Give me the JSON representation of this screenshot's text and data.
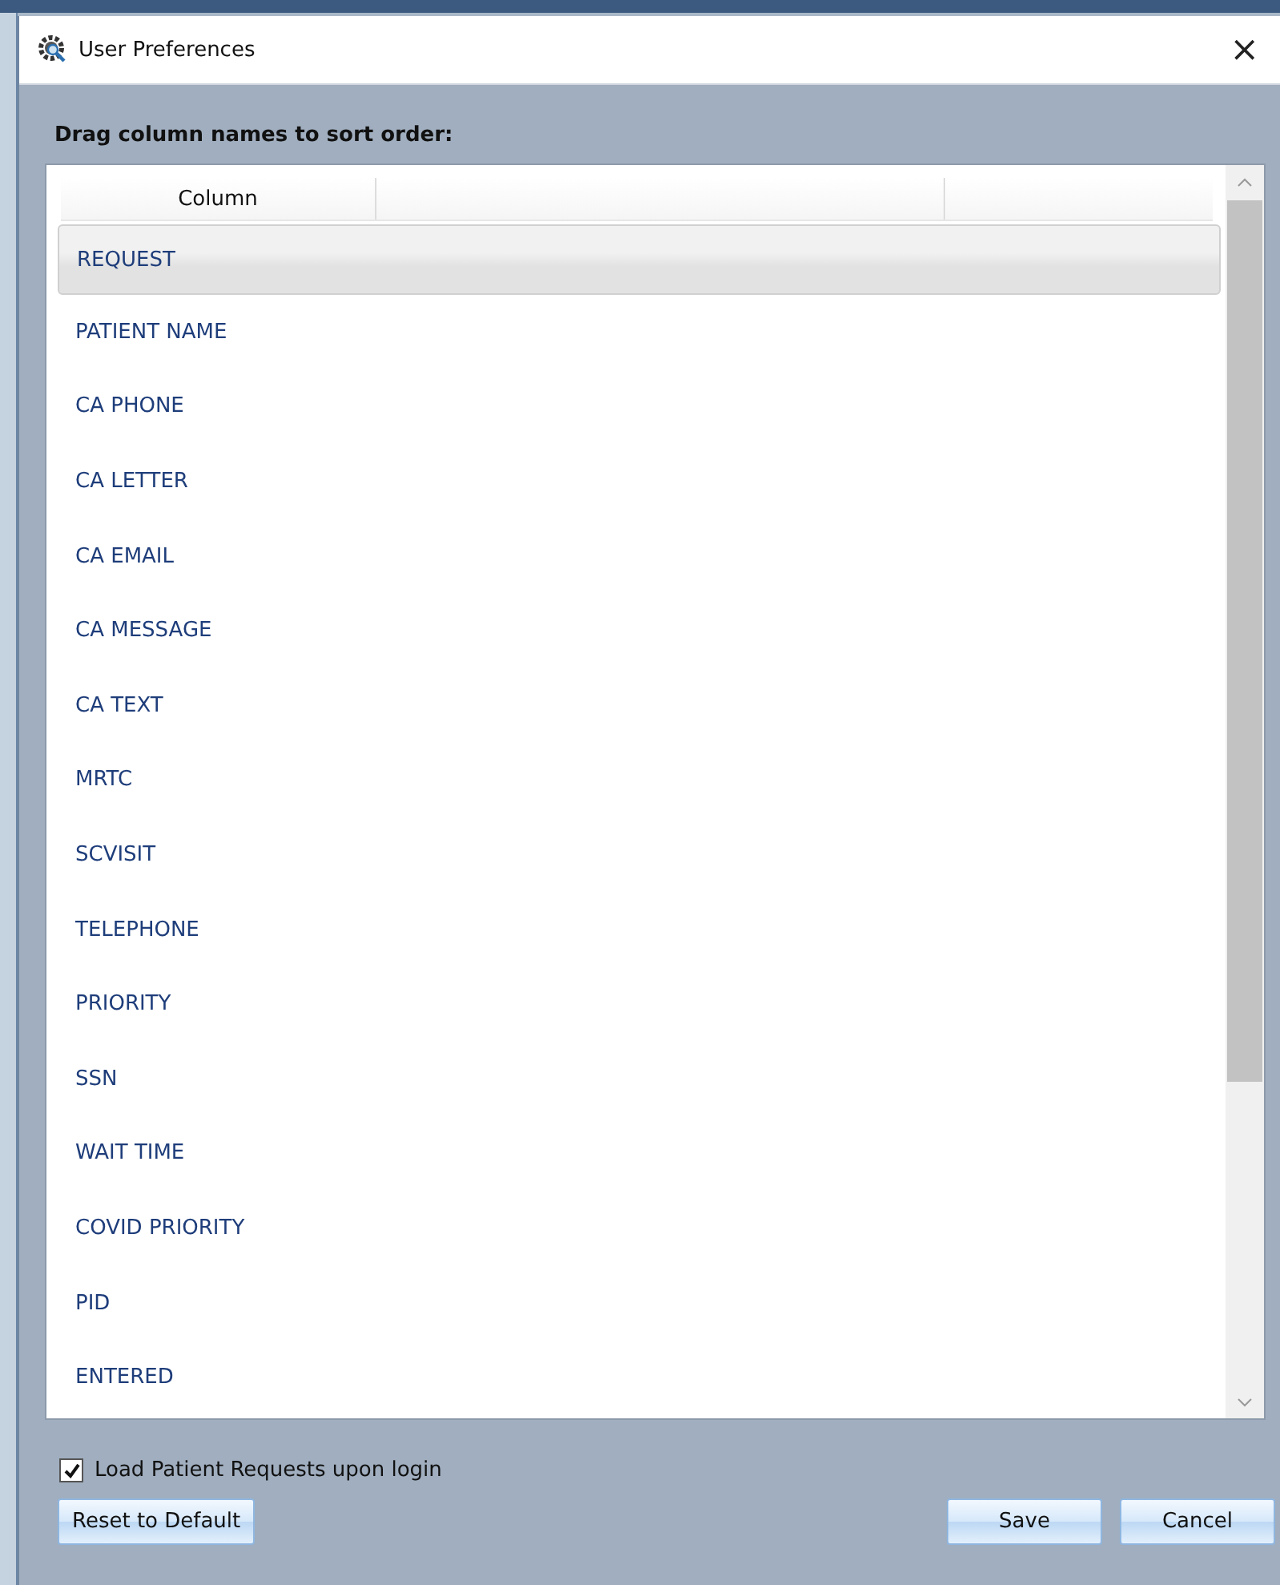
{
  "window": {
    "title": "User Preferences",
    "close": "×"
  },
  "instruction": "Drag column names to sort order:",
  "table": {
    "columns": [
      "Column"
    ],
    "rows": [
      {
        "label": "REQUEST",
        "selected": true
      },
      {
        "label": "PATIENT NAME",
        "selected": false
      },
      {
        "label": "CA PHONE",
        "selected": false
      },
      {
        "label": "CA LETTER",
        "selected": false
      },
      {
        "label": "CA EMAIL",
        "selected": false
      },
      {
        "label": "CA MESSAGE",
        "selected": false
      },
      {
        "label": "CA TEXT",
        "selected": false
      },
      {
        "label": "MRTC",
        "selected": false
      },
      {
        "label": "SCVISIT",
        "selected": false
      },
      {
        "label": "TELEPHONE",
        "selected": false
      },
      {
        "label": "PRIORITY",
        "selected": false
      },
      {
        "label": "SSN",
        "selected": false
      },
      {
        "label": "WAIT TIME",
        "selected": false
      },
      {
        "label": "COVID PRIORITY",
        "selected": false
      },
      {
        "label": "PID",
        "selected": false
      },
      {
        "label": "ENTERED",
        "selected": false
      }
    ]
  },
  "load_on_login": {
    "label": "Load Patient Requests upon login",
    "checked": true
  },
  "buttons": {
    "reset": "Reset to Default",
    "save": "Save",
    "cancel": "Cancel"
  }
}
